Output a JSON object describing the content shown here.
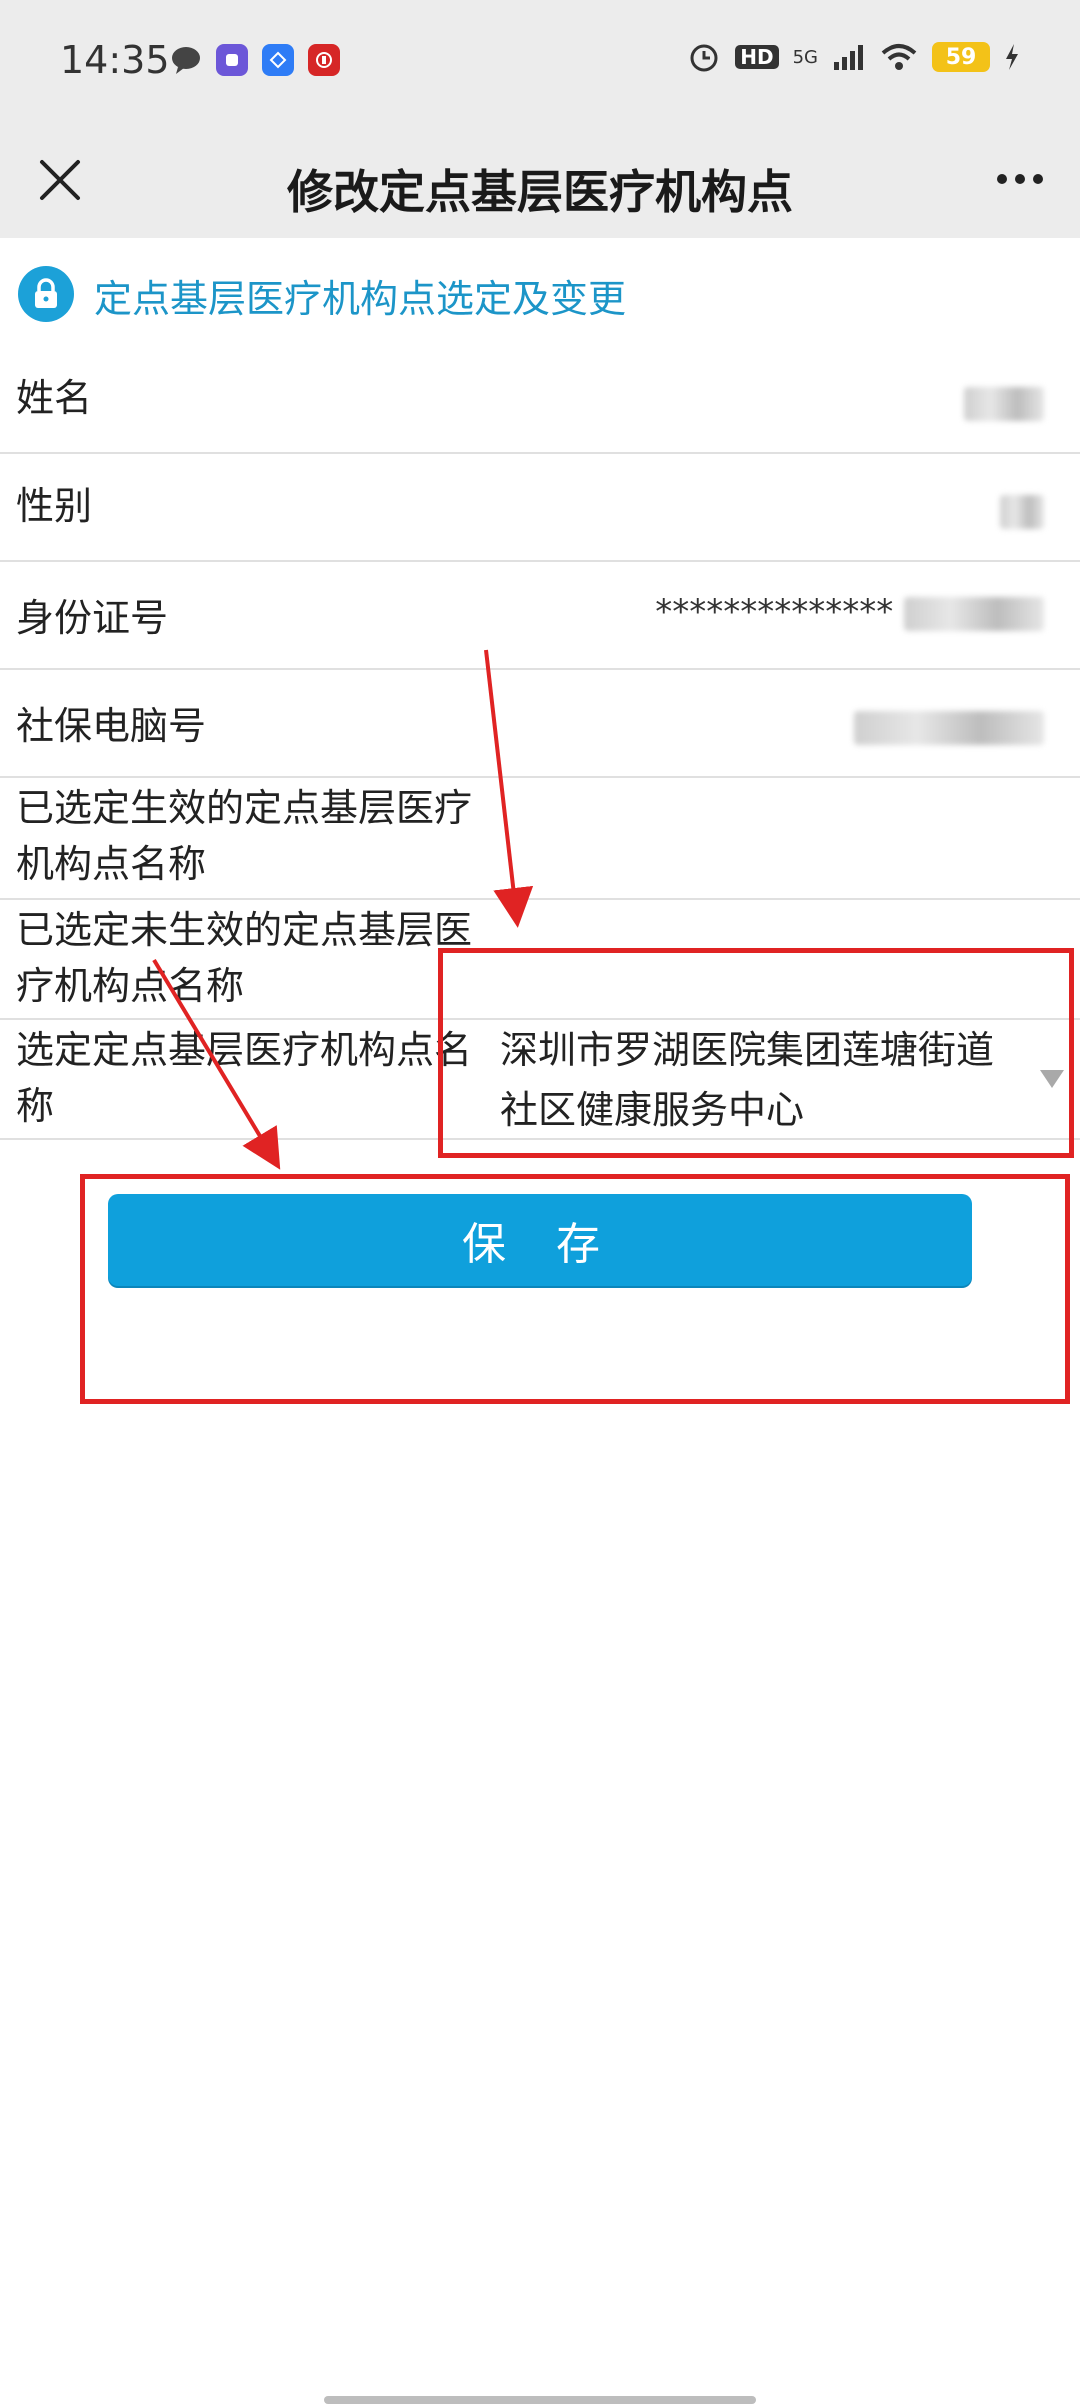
{
  "status_bar": {
    "time": "14:35",
    "left_icons": [
      "chat-bubble-icon",
      "app-badge-icon",
      "blue-app-icon",
      "red-app-icon"
    ],
    "right_text": "HD",
    "network": "5G",
    "battery": "59"
  },
  "nav": {
    "title": "修改定点基层医疗机构点"
  },
  "section": {
    "title": "定点基层医疗机构点选定及变更",
    "icon": "lock-icon",
    "color": "#1c95c8"
  },
  "form": {
    "name_label": "姓名",
    "gender_label": "性别",
    "id_label": "身份证号",
    "id_value_visible": "**************",
    "social_label": "社保电脑号",
    "effective_label_line1": "已选定生效的定点基层医疗",
    "effective_label_line2": "机构点名称",
    "pending_label_line1": "已选定未生效的定点基层医",
    "pending_label_line2": "疗机构点名称",
    "select_label_line1": "选定定点基层医疗机构点名",
    "select_label_line2": "称",
    "select_value_line1": "深圳市罗湖医院集团莲塘街道",
    "select_value_line2": "社区健康服务中心"
  },
  "actions": {
    "save_label": "保 存",
    "save_color": "#0fa0dc"
  },
  "annotation_color": "#e02323"
}
